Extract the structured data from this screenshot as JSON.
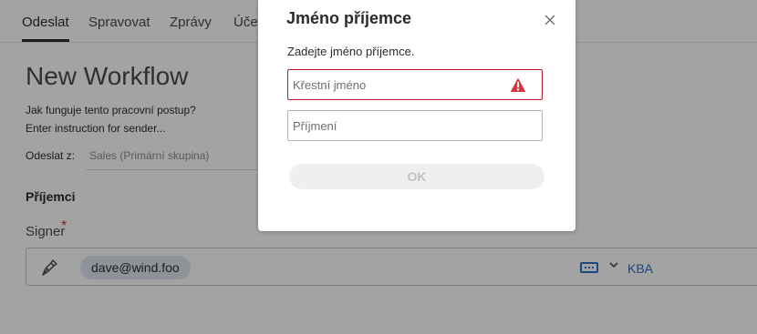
{
  "nav": {
    "tabs": [
      {
        "label": "Odeslat"
      },
      {
        "label": "Spravovat"
      },
      {
        "label": "Zprávy"
      },
      {
        "label": "Účet"
      }
    ]
  },
  "page": {
    "title": "New Workflow",
    "instruction_question": "Jak funguje tento pracovní postup?",
    "instruction_text": "Enter instruction for sender...",
    "send_from_label": "Odeslat z:",
    "send_from_value": "Sales (Primární skupina)",
    "recipients_heading": "Příjemci",
    "signer_label": "Signer",
    "signer_required_mark": "*",
    "signer_email": "dave@wind.foo",
    "auth_label": "KBA"
  },
  "modal": {
    "title": "Jméno příjemce",
    "description": "Zadejte jméno příjemce.",
    "first_name_placeholder": "Křestní jméno",
    "first_name_value": "",
    "last_name_placeholder": "Příjmení",
    "last_name_value": "",
    "ok_label": "OK"
  },
  "icons": {
    "close": "close-icon",
    "warning": "warning-icon",
    "signer": "pen-icon",
    "auth": "password-icon",
    "chevron": "chevron-down-icon"
  },
  "colors": {
    "error_border": "#b41e2a",
    "warning": "#d7373f",
    "link_blue": "#2d6ec9",
    "chip_bg": "#dfe7f0",
    "overlay": "rgba(0,0,0,0.36)"
  }
}
